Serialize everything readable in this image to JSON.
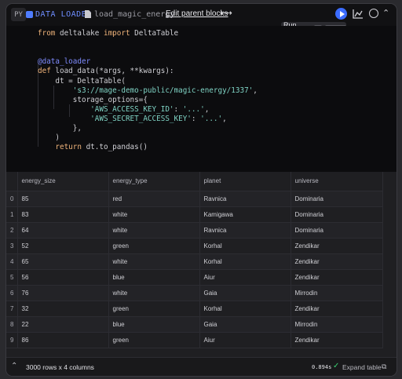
{
  "header": {
    "lang": "PY",
    "block_type": "DATA LOADER",
    "block_name": "load_magic_energy",
    "edit_parent": "Edit parent blocks",
    "arrow_icon": "arrow-both-icon"
  },
  "tooltip": {
    "label": "Run block",
    "key1": "⌘",
    "key2": "enter"
  },
  "code": {
    "lines": [
      {
        "parts": [
          [
            "kw",
            "from "
          ],
          [
            "",
            "deltalake "
          ],
          [
            "kw",
            "import "
          ],
          [
            "",
            "DeltaTable"
          ]
        ]
      },
      {
        "parts": []
      },
      {
        "parts": []
      },
      {
        "parts": [
          [
            "dec",
            "@data_loader"
          ]
        ]
      },
      {
        "parts": [
          [
            "kw",
            "def "
          ],
          [
            "",
            "load_data(*args, **kwargs):"
          ]
        ]
      },
      {
        "parts": [
          [
            "",
            "    dt = DeltaTable("
          ]
        ]
      },
      {
        "parts": [
          [
            "",
            "        "
          ],
          [
            "str",
            "'s3://mage-demo-public/magic-energy/1337'"
          ],
          [
            "",
            ","
          ]
        ]
      },
      {
        "parts": [
          [
            "",
            "        storage_options={"
          ]
        ]
      },
      {
        "parts": [
          [
            "",
            "            "
          ],
          [
            "str",
            "'AWS_ACCESS_KEY_ID'"
          ],
          [
            "",
            ": "
          ],
          [
            "str",
            "'...'"
          ],
          [
            "",
            ","
          ]
        ]
      },
      {
        "parts": [
          [
            "",
            "            "
          ],
          [
            "str",
            "'AWS_SECRET_ACCESS_KEY'"
          ],
          [
            "",
            ": "
          ],
          [
            "str",
            "'...'"
          ],
          [
            "",
            ","
          ]
        ]
      },
      {
        "parts": [
          [
            "",
            "        },"
          ]
        ]
      },
      {
        "parts": [
          [
            "",
            "    )"
          ]
        ]
      },
      {
        "parts": [
          [
            "kw",
            "    return "
          ],
          [
            "",
            "dt.to_pandas()"
          ]
        ]
      }
    ]
  },
  "table": {
    "columns": [
      "energy_size",
      "energy_type",
      "planet",
      "universe"
    ],
    "rows": [
      [
        "0",
        "85",
        "red",
        "Ravnica",
        "Dominaria"
      ],
      [
        "1",
        "83",
        "white",
        "Kamigawa",
        "Dominaria"
      ],
      [
        "2",
        "64",
        "white",
        "Ravnica",
        "Dominaria"
      ],
      [
        "3",
        "52",
        "green",
        "Korhal",
        "Zendikar"
      ],
      [
        "4",
        "65",
        "white",
        "Korhal",
        "Zendikar"
      ],
      [
        "5",
        "56",
        "blue",
        "Aiur",
        "Zendikar"
      ],
      [
        "6",
        "76",
        "white",
        "Gaia",
        "Mirrodin"
      ],
      [
        "7",
        "32",
        "green",
        "Korhal",
        "Zendikar"
      ],
      [
        "8",
        "22",
        "blue",
        "Gaia",
        "Mirrodin"
      ],
      [
        "9",
        "86",
        "green",
        "Aiur",
        "Zendikar"
      ]
    ]
  },
  "footer": {
    "rows_label": "3000 rows x 4 columns",
    "time": "0.894s",
    "expand_label": "Expand table"
  },
  "colors": {
    "accent": "#3b6cff",
    "success": "#3bcf72",
    "code_bg": "#0c0c0e"
  }
}
